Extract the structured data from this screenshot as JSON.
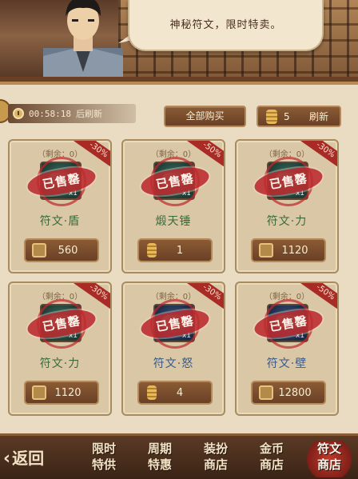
{
  "npc": {
    "speech": "神秘符文，限时特卖。"
  },
  "toolbar": {
    "timer": "00:58:18",
    "timer_suffix": "后刷新",
    "buy_all_label": "全部购买",
    "refresh_cost": "5",
    "refresh_label": "刷新"
  },
  "cards": [
    {
      "remain": "（剩余：0）",
      "discount": "-30%",
      "sold": "已售罄",
      "qty": "x1",
      "name": "符文·盾",
      "currency": "coin",
      "price": "560",
      "item_color": "green",
      "name_color": "green"
    },
    {
      "remain": "（剩余：0）",
      "discount": "-50%",
      "sold": "已售罄",
      "qty": "x1",
      "name": "煅天锤",
      "currency": "token",
      "price": "1",
      "item_color": "green",
      "name_color": "green"
    },
    {
      "remain": "（剩余：0）",
      "discount": "-30%",
      "sold": "已售罄",
      "qty": "x1",
      "name": "符文·力",
      "currency": "coin",
      "price": "1120",
      "item_color": "green",
      "name_color": "green"
    },
    {
      "remain": "（剩余：0）",
      "discount": "-30%",
      "sold": "已售罄",
      "qty": "x1",
      "name": "符文·力",
      "currency": "coin",
      "price": "1120",
      "item_color": "green",
      "name_color": "green"
    },
    {
      "remain": "（剩余：0）",
      "discount": "-30%",
      "sold": "已售罄",
      "qty": "x1",
      "name": "符文·怒",
      "currency": "token",
      "price": "4",
      "item_color": "blue",
      "name_color": "blue"
    },
    {
      "remain": "（剩余：0）",
      "discount": "-50%",
      "sold": "已售罄",
      "qty": "x1",
      "name": "符文·壁",
      "currency": "coin",
      "price": "12800",
      "item_color": "blue",
      "name_color": "blue"
    }
  ],
  "nav": {
    "back": "返回",
    "tabs": [
      {
        "l1": "限时",
        "l2": "特供"
      },
      {
        "l1": "周期",
        "l2": "特惠"
      },
      {
        "l1": "装扮",
        "l2": "商店"
      },
      {
        "l1": "金币",
        "l2": "商店"
      },
      {
        "l1": "符文",
        "l2": "商店"
      }
    ]
  }
}
